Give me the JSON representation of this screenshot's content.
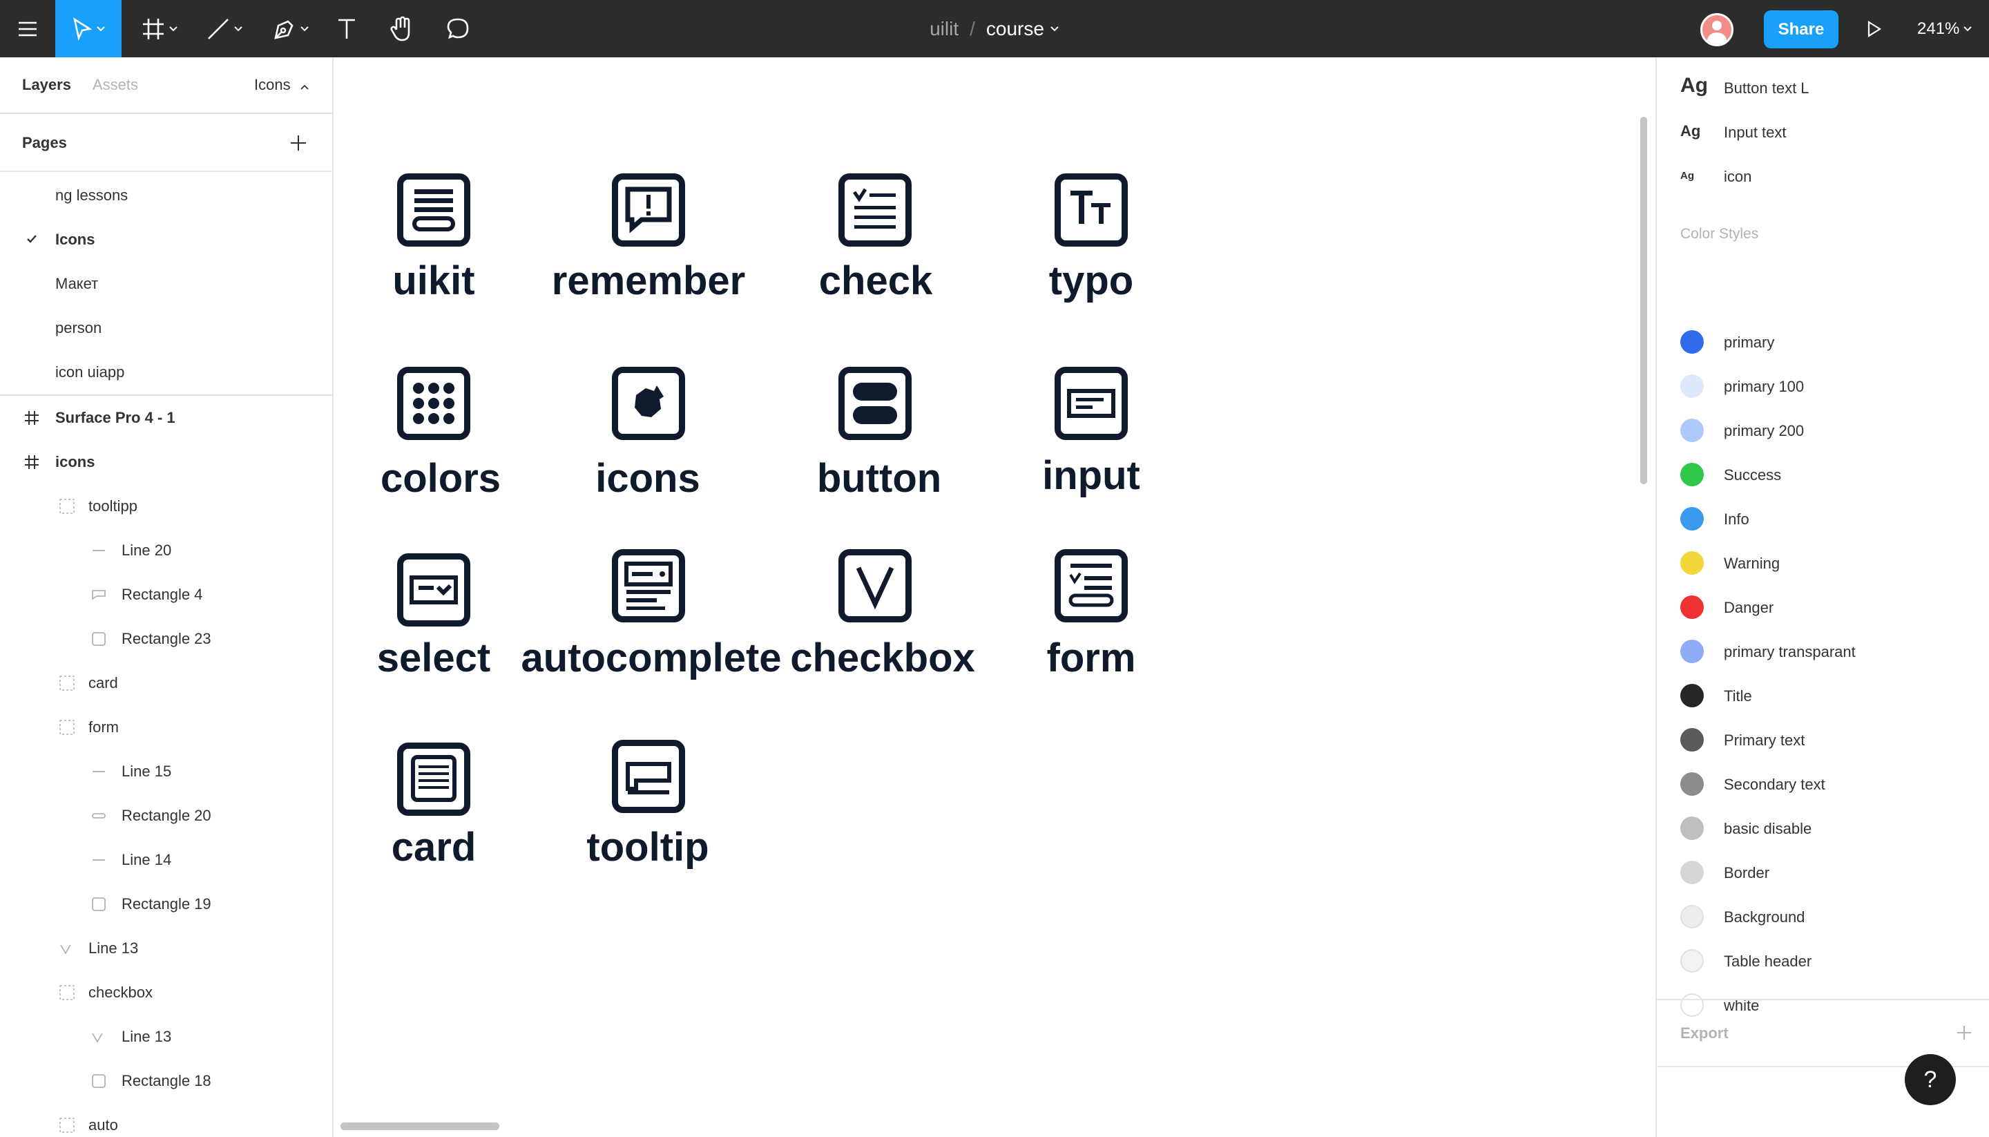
{
  "toolbar": {
    "project": "uilit",
    "separator": "/",
    "file": "course",
    "share_label": "Share",
    "zoom": "241%",
    "icons": [
      "menu-icon",
      "move-tool-icon",
      "frame-tool-icon",
      "line-tool-icon",
      "pen-tool-icon",
      "text-tool-icon",
      "hand-tool-icon",
      "comment-tool-icon",
      "play-icon"
    ]
  },
  "left_panel": {
    "tab_layers": "Layers",
    "tab_assets": "Assets",
    "page_selector": "Icons",
    "pages_title": "Pages",
    "pages": [
      {
        "label": "ng lessons",
        "selected": false
      },
      {
        "label": "Icons",
        "selected": true
      },
      {
        "label": "Макет",
        "selected": false
      },
      {
        "label": "person",
        "selected": false
      },
      {
        "label": "icon uiapp",
        "selected": false
      }
    ],
    "layers": [
      {
        "label": "Surface Pro 4 - 1",
        "type": "frame",
        "depth": 0
      },
      {
        "label": "icons",
        "type": "frame",
        "depth": 0
      },
      {
        "label": "tooltipp",
        "type": "group",
        "depth": 1
      },
      {
        "label": "Line 20",
        "type": "line",
        "depth": 2
      },
      {
        "label": "Rectangle 4",
        "type": "vector",
        "depth": 2
      },
      {
        "label": "Rectangle 23",
        "type": "rect",
        "depth": 2
      },
      {
        "label": "card",
        "type": "group",
        "depth": 1
      },
      {
        "label": "form",
        "type": "group",
        "depth": 1
      },
      {
        "label": "Line 15",
        "type": "line",
        "depth": 2
      },
      {
        "label": "Rectangle 20",
        "type": "pill",
        "depth": 2
      },
      {
        "label": "Line 14",
        "type": "line",
        "depth": 2
      },
      {
        "label": "Rectangle 19",
        "type": "rect",
        "depth": 2
      },
      {
        "label": "Line 13",
        "type": "vector-v",
        "depth": 1
      },
      {
        "label": "checkbox",
        "type": "group",
        "depth": 1
      },
      {
        "label": "Line 13",
        "type": "vector-v",
        "depth": 2
      },
      {
        "label": "Rectangle 18",
        "type": "rect",
        "depth": 2
      },
      {
        "label": "auto",
        "type": "group",
        "depth": 1
      }
    ]
  },
  "canvas": {
    "icons": [
      {
        "label": "uikit",
        "icon": "uikit-icon"
      },
      {
        "label": "remember",
        "icon": "remember-icon"
      },
      {
        "label": "check",
        "icon": "check-icon"
      },
      {
        "label": "typo",
        "icon": "typo-icon"
      },
      {
        "label": "colors",
        "icon": "colors-icon"
      },
      {
        "label": "icons",
        "icon": "icons-icon"
      },
      {
        "label": "button",
        "icon": "button-icon"
      },
      {
        "label": "input",
        "icon": "input-icon"
      },
      {
        "label": "select",
        "icon": "select-icon"
      },
      {
        "label": "autocomplete",
        "icon": "autocomplete-icon"
      },
      {
        "label": "checkbox",
        "icon": "checkbox-icon"
      },
      {
        "label": "form",
        "icon": "form-icon"
      },
      {
        "label": "card",
        "icon": "card-icon"
      },
      {
        "label": "tooltip",
        "icon": "tooltip-icon"
      }
    ],
    "typo_glyph": "TT"
  },
  "right_panel": {
    "text_styles": [
      {
        "sample": "Ag",
        "name": "Button text L"
      },
      {
        "sample": "Ag",
        "name": "Input text"
      },
      {
        "sample": "Ag",
        "name": "icon"
      }
    ],
    "color_styles_title": "Color Styles",
    "color_styles": [
      {
        "name": "primary",
        "color": "#2f6bec"
      },
      {
        "name": "primary 100",
        "color": "#dde8fd"
      },
      {
        "name": "primary 200",
        "color": "#afc8fa"
      },
      {
        "name": "Success",
        "color": "#2fc84a"
      },
      {
        "name": "Info",
        "color": "#3a9af0"
      },
      {
        "name": "Warning",
        "color": "#f2d63a"
      },
      {
        "name": "Danger",
        "color": "#ee3131"
      },
      {
        "name": "primary transparant",
        "color": "#8fabf5"
      },
      {
        "name": "Title",
        "color": "#262626"
      },
      {
        "name": "Primary text",
        "color": "#5a5a5a"
      },
      {
        "name": "Secondary text",
        "color": "#8c8c8c"
      },
      {
        "name": "basic disable",
        "color": "#bfbfbf"
      },
      {
        "name": "Border",
        "color": "#d6d6d6"
      },
      {
        "name": "Background",
        "color": "#ececec"
      },
      {
        "name": "Table header",
        "color": "#f2f2f2"
      },
      {
        "name": "white",
        "color": "#ffffff"
      }
    ],
    "export_title": "Export",
    "help_label": "?"
  }
}
